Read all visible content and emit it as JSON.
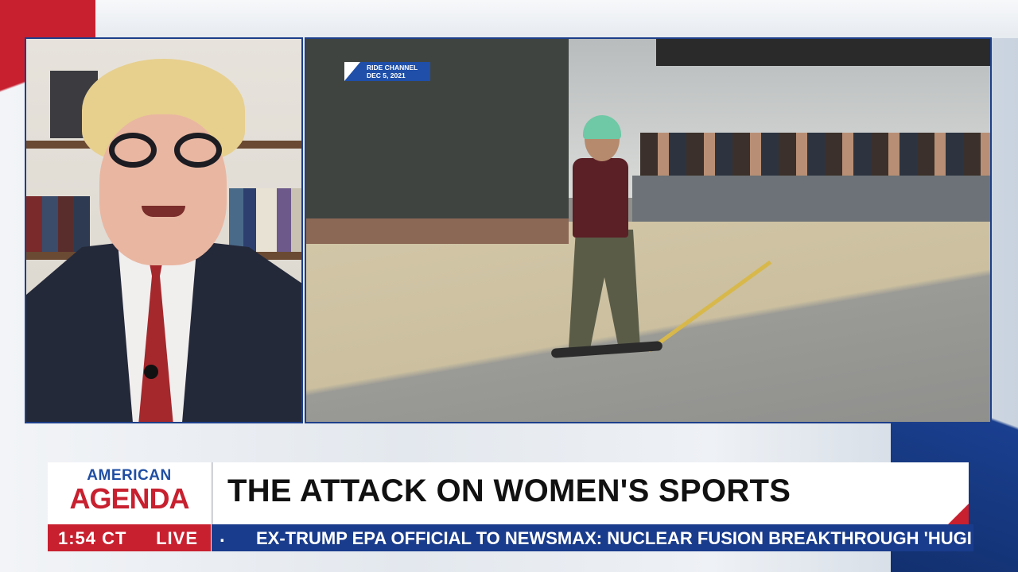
{
  "video": {
    "source_tag": {
      "channel": "RIDE CHANNEL",
      "date": "DEC 5, 2021"
    }
  },
  "lower_third": {
    "logo_top": "AMERICAN",
    "logo_bottom": "AGENDA",
    "headline": "THE ATTACK ON WOMEN'S SPORTS",
    "time": "1:54 CT",
    "live": "LIVE",
    "ticker_bullet": ".",
    "ticker_text": "EX-TRUMP EPA OFFICIAL TO NEWSMAX: NUCLEAR FUSION BREAKTHROUGH 'HUGI"
  },
  "colors": {
    "brand_blue": "#1a3c8c",
    "brand_red": "#c8202f"
  }
}
